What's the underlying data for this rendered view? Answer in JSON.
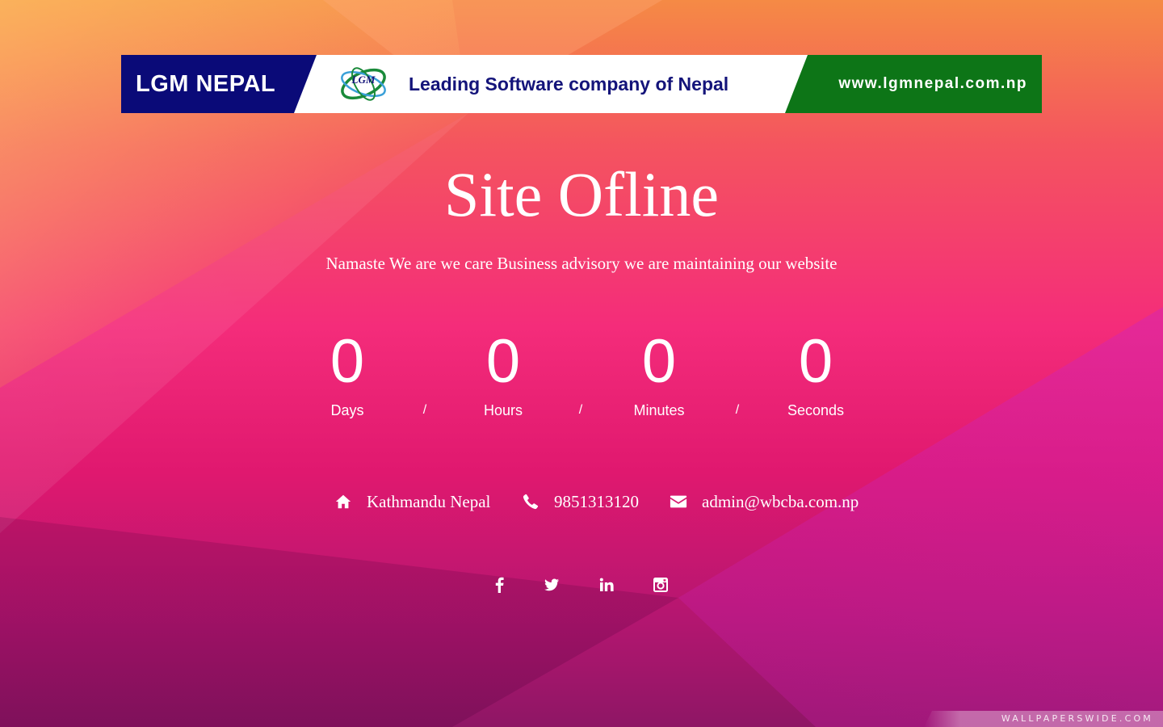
{
  "banner": {
    "brand": "LGM NEPAL",
    "tagline": "Leading Software company of Nepal",
    "url": "www.lgmnepal.com.np",
    "colors": {
      "left": "#0a0a78",
      "right": "#0d7517",
      "tagline": "#14147a"
    }
  },
  "page": {
    "title": "Site Ofline",
    "subtitle": "Namaste We are we care Business advisory we are maintaining our website"
  },
  "countdown": {
    "units": [
      {
        "value": "0",
        "label": "Days"
      },
      {
        "value": "0",
        "label": "Hours"
      },
      {
        "value": "0",
        "label": "Minutes"
      },
      {
        "value": "0",
        "label": "Seconds"
      }
    ],
    "separator": "/"
  },
  "contact": {
    "address": {
      "icon": "home-icon",
      "text": "Kathmandu Nepal"
    },
    "phone": {
      "icon": "phone-icon",
      "text": "9851313120"
    },
    "email": {
      "icon": "envelope-icon",
      "text": "admin@wbcba.com.np"
    }
  },
  "social": [
    {
      "icon": "facebook-icon"
    },
    {
      "icon": "twitter-icon"
    },
    {
      "icon": "linkedin-icon"
    },
    {
      "icon": "instagram-icon"
    }
  ],
  "watermark": "WALLPAPERSWIDE.COM"
}
